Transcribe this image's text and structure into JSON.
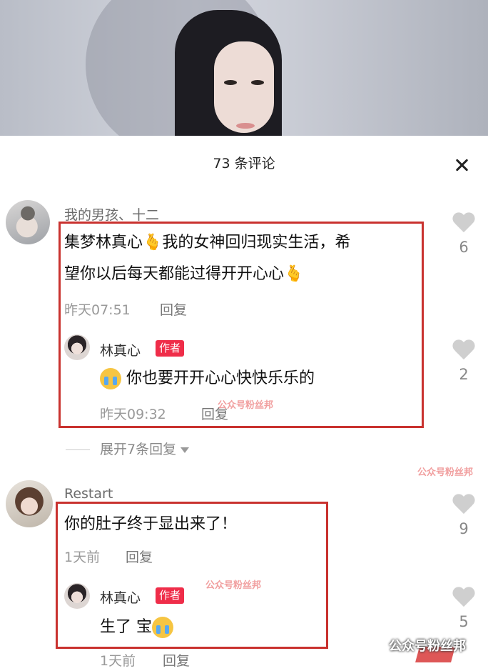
{
  "sheet": {
    "title": "73 条评论"
  },
  "comments": [
    {
      "username": "我的男孩、十二",
      "text_line1": "集梦林真心",
      "text_line1_b": "我的女神回归现实生活，希",
      "text_line2": "望你以后每天都能过得开开心心",
      "emoji": "🫰",
      "time": "昨天07:51",
      "reply_label": "回复",
      "likes": "6",
      "author_reply": {
        "name": "林真心",
        "badge": "作者",
        "text": "你也要开开心心快快乐乐的",
        "time": "昨天09:32",
        "reply_label": "回复",
        "likes": "2"
      },
      "expand_label": "展开7条回复"
    },
    {
      "username": "Restart",
      "text": "你的肚子终于显出来了！",
      "time": "1天前",
      "reply_label": "回复",
      "likes": "9",
      "author_reply": {
        "name": "林真心",
        "badge": "作者",
        "text": "生了 宝",
        "time": "1天前",
        "reply_label": "回复",
        "likes": "5"
      }
    }
  ],
  "watermark": {
    "text": "公众号粉丝邦"
  },
  "colors": {
    "badge": "#ef2d49",
    "highlight_box": "#c9322f",
    "heart": "#cfcfcf"
  }
}
